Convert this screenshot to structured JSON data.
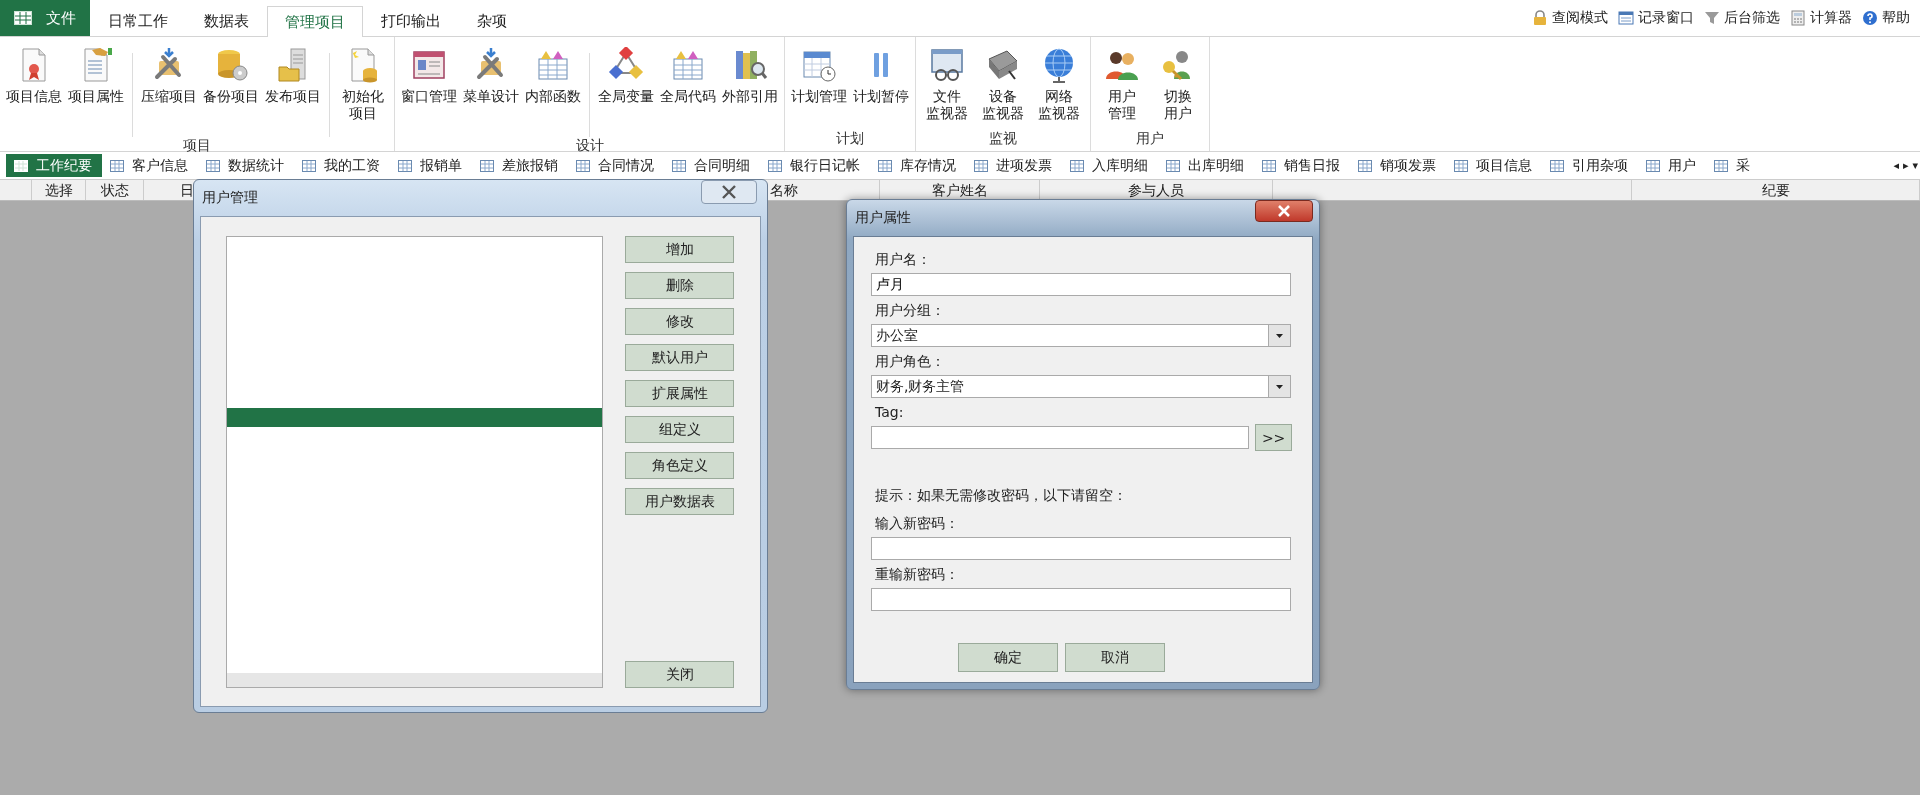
{
  "top_tabs": [
    {
      "label": "文件",
      "kind": "file",
      "selected": false
    },
    {
      "label": "日常工作",
      "kind": "tab",
      "selected": false
    },
    {
      "label": "数据表",
      "kind": "tab",
      "selected": false
    },
    {
      "label": "管理项目",
      "kind": "tab",
      "selected": true
    },
    {
      "label": "打印输出",
      "kind": "tab",
      "selected": false
    },
    {
      "label": "杂项",
      "kind": "tab",
      "selected": false
    }
  ],
  "quick_bar": [
    "查阅模式",
    "记录窗口",
    "后台筛选",
    "计算器",
    "帮助"
  ],
  "ribbon_groups": [
    {
      "label": "项目",
      "clusters": [
        [
          [
            "项目信息"
          ],
          [
            "项目属性"
          ]
        ],
        [
          [
            "压缩项目"
          ],
          [
            "备份项目"
          ],
          [
            "发布项目"
          ]
        ],
        [
          [
            "初始化",
            "项目"
          ]
        ]
      ]
    },
    {
      "label": "设计",
      "clusters": [
        [
          [
            "窗口管理"
          ],
          [
            "菜单设计"
          ],
          [
            "内部函数"
          ]
        ],
        [
          [
            "全局变量"
          ],
          [
            "全局代码"
          ],
          [
            "外部引用"
          ]
        ]
      ]
    },
    {
      "label": "计划",
      "clusters": [
        [
          [
            "计划管理"
          ],
          [
            "计划暂停"
          ]
        ]
      ]
    },
    {
      "label": "监视",
      "clusters": [
        [
          [
            "文件",
            "监视器"
          ],
          [
            "设备",
            "监视器"
          ],
          [
            "网络",
            "监视器"
          ]
        ]
      ]
    },
    {
      "label": "用户",
      "clusters": [
        [
          [
            "用户",
            "管理"
          ],
          [
            "切换",
            "用户"
          ]
        ]
      ]
    }
  ],
  "doc_tabs": [
    {
      "label": "工作纪要",
      "selected": true
    },
    {
      "label": "客户信息",
      "selected": false
    },
    {
      "label": "数据统计",
      "selected": false
    },
    {
      "label": "我的工资",
      "selected": false
    },
    {
      "label": "报销单",
      "selected": false
    },
    {
      "label": "差旅报销",
      "selected": false
    },
    {
      "label": "合同情况",
      "selected": false
    },
    {
      "label": "合同明细",
      "selected": false
    },
    {
      "label": "银行日记帐",
      "selected": false
    },
    {
      "label": "库存情况",
      "selected": false
    },
    {
      "label": "进项发票",
      "selected": false
    },
    {
      "label": "入库明细",
      "selected": false
    },
    {
      "label": "出库明细",
      "selected": false
    },
    {
      "label": "销售日报",
      "selected": false
    },
    {
      "label": "销项发票",
      "selected": false
    },
    {
      "label": "项目信息",
      "selected": false
    },
    {
      "label": "引用杂项",
      "selected": false
    },
    {
      "label": "用户",
      "selected": false
    },
    {
      "label": "采",
      "selected": false
    }
  ],
  "tab_nav": [
    "◂",
    "▸",
    "▾"
  ],
  "table": {
    "columns": [
      "",
      "选择",
      "状态",
      "日",
      "名称",
      "客户姓名",
      "参与人员",
      "",
      "纪要"
    ]
  },
  "user_manager": {
    "title": "用户管理",
    "rows": [
      {
        "selected": false
      },
      {
        "selected": false
      },
      {
        "selected": false
      },
      {
        "selected": false
      },
      {
        "selected": false
      },
      {
        "selected": false
      },
      {
        "selected": false
      },
      {
        "selected": false
      },
      {
        "selected": false
      },
      {
        "selected": true
      }
    ],
    "buttons": [
      "增加",
      "删除",
      "修改",
      "默认用户",
      "扩展属性",
      "组定义",
      "角色定义",
      "用户数据表"
    ],
    "close_button": "关闭"
  },
  "user_properties": {
    "title": "用户属性",
    "fields": [
      {
        "label": "用户名：",
        "kind": "text",
        "value": "卢月"
      },
      {
        "label": "用户分组：",
        "kind": "select",
        "value": "办公室"
      },
      {
        "label": "用户角色：",
        "kind": "select",
        "value": "财务,财务主管"
      },
      {
        "label": "Tag:",
        "kind": "tag",
        "button": ">>"
      },
      {
        "kind": "hint",
        "label": "提示：如果无需修改密码，以下请留空："
      },
      {
        "label": "输入新密码：",
        "kind": "text"
      },
      {
        "label": "重输新密码：",
        "kind": "text"
      }
    ],
    "buttons": [
      "确定",
      "取消"
    ]
  }
}
